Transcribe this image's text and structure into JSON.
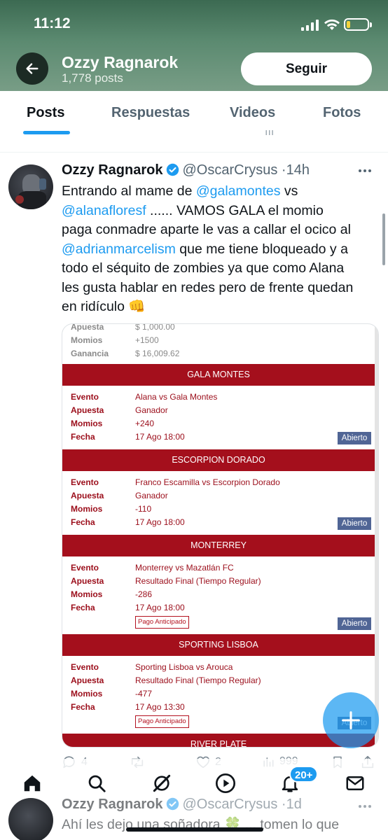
{
  "status_bar": {
    "time": "11:12"
  },
  "profile": {
    "name": "Ozzy Ragnarok",
    "posts_count": "1,778 posts",
    "follow_label": "Seguir"
  },
  "tabs": [
    {
      "label": "Posts"
    },
    {
      "label": "Respuestas"
    },
    {
      "label": "Videos"
    },
    {
      "label": "Fotos"
    }
  ],
  "tweet": {
    "author_name": "Ozzy Ragnarok",
    "handle": "@OscarCrysus",
    "separator": "·",
    "time": "14h",
    "lines": {
      "l1_text": "Entrando al mame de ",
      "l1_link": "@galamontes",
      "l1_after": " vs",
      "l2_link": "@alanafloresf",
      "l2_after": "  ...... VAMOS GALA el momio",
      "l3": "paga conmadre aparte le vas a callar el ocico al",
      "l4_link": "@adrianmarcelism",
      "l4_after": "  que me tiene bloqueado y a",
      "l5": "todo el séquito de zombies ya que como Alana",
      "l6": "les gusta hablar en redes pero de frente quedan",
      "l7": "en ridículo 👊"
    },
    "metrics": {
      "replies": "4",
      "likes": "2",
      "views": "999"
    }
  },
  "bet_slip": {
    "summary": [
      {
        "key": "Apuesta",
        "value": "$ 1,000.00"
      },
      {
        "key": "Momios",
        "value": "+1500"
      },
      {
        "key": "Ganancia",
        "value": "$ 16,009.62"
      }
    ],
    "field_labels": {
      "evento": "Evento",
      "apuesta": "Apuesta",
      "momios": "Momios",
      "fecha": "Fecha"
    },
    "status_label": "Abierto",
    "prepaid_label": "Pago Anticipado",
    "bets": [
      {
        "header": "GALA MONTES",
        "evento": "Alana vs Gala Montes",
        "apuesta": "Ganador",
        "momios": "+240",
        "fecha": "17 Ago 18:00"
      },
      {
        "header": "ESCORPION DORADO",
        "evento": "Franco Escamilla vs Escorpion Dorado",
        "apuesta": "Ganador",
        "momios": "-110",
        "fecha": "17 Ago 18:00"
      },
      {
        "header": "MONTERREY",
        "evento": "Monterrey vs Mazatlán FC",
        "apuesta": "Resultado Final (Tiempo Regular)",
        "momios": "-286",
        "fecha": "17 Ago 18:00"
      },
      {
        "header": "SPORTING LISBOA",
        "evento": "Sporting Lisboa vs Arouca",
        "apuesta": "Resultado Final (Tiempo Regular)",
        "momios": "-477",
        "fecha": "17 Ago 13:30"
      },
      {
        "header": "RIVER PLATE"
      }
    ]
  },
  "bottom_nav": {
    "notifications_badge": "20+"
  },
  "next_tweet": {
    "author_name": "Ozzy Ragnarok",
    "handle": "@OscarCrysus",
    "separator": "·",
    "time": "1d",
    "text": "Ahí les dejo una soñadora 🍀 ... tomen lo que"
  },
  "colors": {
    "accent": "#1d9bf0",
    "bet_red": "#a40f1c",
    "status_blue": "#506595",
    "header_green": "#5b8a70"
  }
}
